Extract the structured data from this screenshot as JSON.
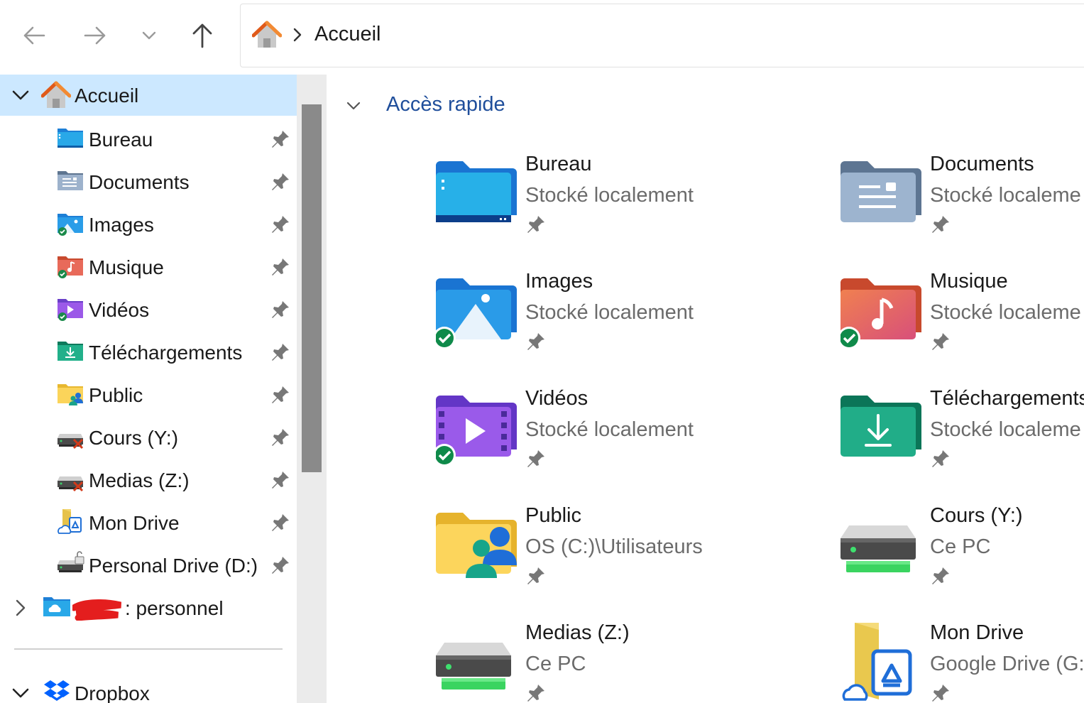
{
  "nav": {
    "back_icon": "arrow-left-icon",
    "forward_icon": "arrow-right-icon",
    "recent_icon": "chevron-down-icon",
    "up_icon": "arrow-up-icon"
  },
  "address": {
    "location": "Accueil"
  },
  "sidebar": {
    "home": {
      "label": "Accueil"
    },
    "items": [
      {
        "label": "Bureau"
      },
      {
        "label": "Documents"
      },
      {
        "label": "Images"
      },
      {
        "label": "Musique"
      },
      {
        "label": "Vidéos"
      },
      {
        "label": "Téléchargements"
      },
      {
        "label": "Public"
      },
      {
        "label": "Cours (Y:)"
      },
      {
        "label": "Medias (Z:)"
      },
      {
        "label": "Mon Drive"
      },
      {
        "label": "Personal Drive (D:)"
      }
    ],
    "onedrive": {
      "label": ": personnel"
    },
    "dropbox": {
      "label": "Dropbox"
    }
  },
  "content": {
    "section_title": "Accès rapide",
    "tiles": [
      {
        "name": "Bureau",
        "location": "Stocké localement"
      },
      {
        "name": "Documents",
        "location": "Stocké localeme"
      },
      {
        "name": "Images",
        "location": "Stocké localement"
      },
      {
        "name": "Musique",
        "location": "Stocké localeme"
      },
      {
        "name": "Vidéos",
        "location": "Stocké localement"
      },
      {
        "name": "Téléchargements",
        "location": "Stocké localeme"
      },
      {
        "name": "Public",
        "location": "OS (C:)\\Utilisateurs"
      },
      {
        "name": "Cours (Y:)",
        "location": "Ce PC"
      },
      {
        "name": "Medias (Z:)",
        "location": "Ce PC"
      },
      {
        "name": "Mon Drive",
        "location": "Google Drive (G:"
      }
    ]
  },
  "colors": {
    "selection": "#cce8ff",
    "accent_text": "#1f4e9b",
    "scroll_thumb": "#8a8a8a"
  }
}
